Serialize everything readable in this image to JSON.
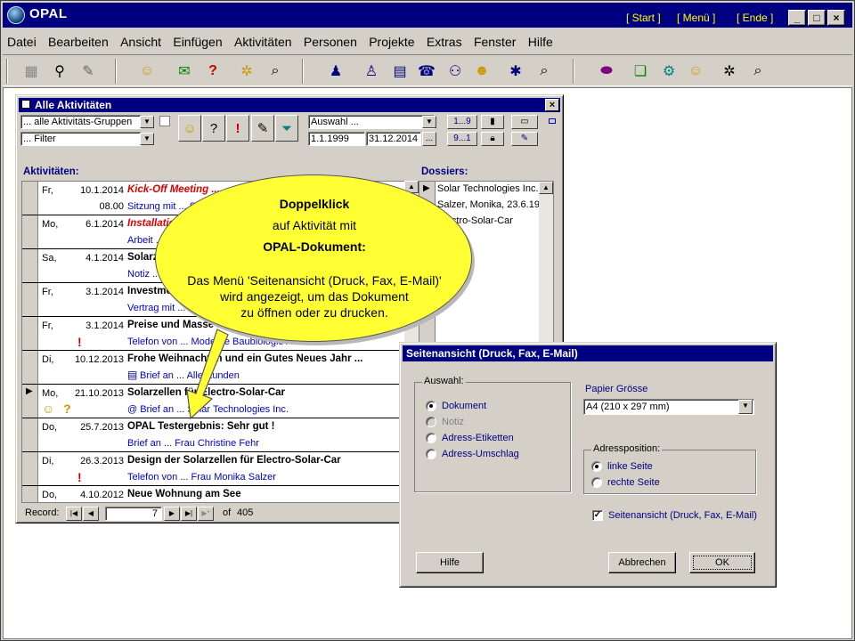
{
  "app": {
    "title": "OPAL",
    "links": [
      "[ Start ]",
      "[ Menü ]",
      "[ Ende ]"
    ],
    "window_buttons": [
      "_",
      "□",
      "×"
    ]
  },
  "menu": [
    "Datei",
    "Bearbeiten",
    "Ansicht",
    "Einfügen",
    "Aktivitäten",
    "Personen",
    "Projekte",
    "Extras",
    "Fenster",
    "Hilfe"
  ],
  "toolbar_icons": [
    "grid-icon",
    "binoculars-icon",
    "eraser-icon",
    "smiley-icon",
    "note-question-icon",
    "question-icon",
    "star-smiley-icon",
    "search-doc-icon",
    "people-icon",
    "person-doc-icon",
    "notepad-icon",
    "phone-icon",
    "couple-icon",
    "person-smiley-icon",
    "star-person-icon",
    "search-person-icon",
    "pills-icon",
    "doc-smiley-icon",
    "gears-icon",
    "smiley2-icon",
    "star-gear-icon",
    "search-doc2-icon"
  ],
  "activities": {
    "title": "Alle Aktivitäten",
    "group_select": "... alle Aktivitäts-Gruppen",
    "filter_select": "... Filter",
    "auswahl_select": "Auswahl ...",
    "date_from": "1.1.1999",
    "date_to": "31.12.2014",
    "range_top": "1...9",
    "range_bottom": "9...1",
    "ellipsis": "...",
    "list_label": "Aktivitäten:",
    "dossiers_label": "Dossiers:",
    "rows": [
      {
        "day": "Fr,",
        "date": "10.1.2014",
        "time": "08.00",
        "subject": "Kick-Off Meeting ...",
        "detail": "Sitzung mit ... Solar T",
        "red": true,
        "icons": ""
      },
      {
        "day": "Mo,",
        "date": "6.1.2014",
        "time": "",
        "subject": "Installation",
        "detail": "Arbeit ... S",
        "red": true,
        "icons": ""
      },
      {
        "day": "Sa,",
        "date": "4.1.2014",
        "time": "",
        "subject": "Solarze",
        "detail": "Notiz ... S",
        "red": false,
        "icons": ""
      },
      {
        "day": "Fr,",
        "date": "3.1.2014",
        "time": "",
        "subject": "Investment",
        "detail": "Vertrag mit ... S",
        "red": false,
        "icons": ""
      },
      {
        "day": "Fr,",
        "date": "3.1.2014",
        "time": "",
        "subject": "Preise und Masse f",
        "detail": "Telefon von ... Moderne Baubiologie AG",
        "red": false,
        "icons": "!"
      },
      {
        "day": "Di,",
        "date": "10.12.2013",
        "time": "",
        "subject": "Frohe Weihnachten und ein Gutes Neues Jahr ...",
        "detail": "Brief an ... Alle Kunden",
        "red": false,
        "icons": "doc"
      },
      {
        "day": "Mo,",
        "date": "21.10.2013",
        "time": "",
        "subject": "Solarzellen für Electro-Solar-Car",
        "detail": "@ Brief an ... Solar Technologies Inc.",
        "red": false,
        "icons": "☺ ?"
      },
      {
        "day": "Do,",
        "date": "25.7.2013",
        "time": "",
        "subject": "OPAL Testergebnis: Sehr gut !",
        "detail": "Brief an ... Frau Christine Fehr",
        "red": false,
        "icons": ""
      },
      {
        "day": "Di,",
        "date": "26.3.2013",
        "time": "",
        "subject": "Design der Solarzellen für Electro-Solar-Car",
        "detail": "Telefon von ... Frau Monika Salzer",
        "red": false,
        "icons": "!"
      },
      {
        "day": "Do,",
        "date": "4.10.2012",
        "time": "",
        "subject": "Neue Wohnung am See",
        "detail": "",
        "red": false,
        "icons": ""
      }
    ],
    "dossiers": [
      "Solar Technologies Inc.",
      "Salzer, Monika, 23.6.196",
      "Electro-Solar-Car"
    ],
    "record_label": "Record:",
    "record_value": "7",
    "record_of": "of",
    "record_total": "405"
  },
  "callout": {
    "line1": "Doppelklick",
    "line2": "auf Aktivität mit",
    "line3": "OPAL-Dokument:",
    "line4": "Das Menü 'Seitenansicht (Druck, Fax, E-Mail)'",
    "line5": "wird angezeigt, um das Dokument",
    "line6": "zu öffnen oder zu drucken."
  },
  "dialog": {
    "title": "Seitenansicht (Druck, Fax, E-Mail)",
    "auswahl_label": "Auswahl:",
    "options": [
      {
        "label": "Dokument",
        "checked": true,
        "disabled": false
      },
      {
        "label": "Notiz",
        "checked": false,
        "disabled": true
      },
      {
        "label": "Adress-Etiketten",
        "checked": false,
        "disabled": false
      },
      {
        "label": "Adress-Umschlag",
        "checked": false,
        "disabled": false
      }
    ],
    "paper_label": "Papier Grösse",
    "paper_value": "A4 (210 x 297 mm)",
    "adress_label": "Adressposition:",
    "adress_options": [
      {
        "label": "linke Seite",
        "checked": true
      },
      {
        "label": "rechte Seite",
        "checked": false
      }
    ],
    "checkbox_label": "Seitenansicht (Druck, Fax, E-Mail)",
    "help_button": "Hilfe",
    "cancel_button": "Abbrechen",
    "ok_button": "OK"
  }
}
